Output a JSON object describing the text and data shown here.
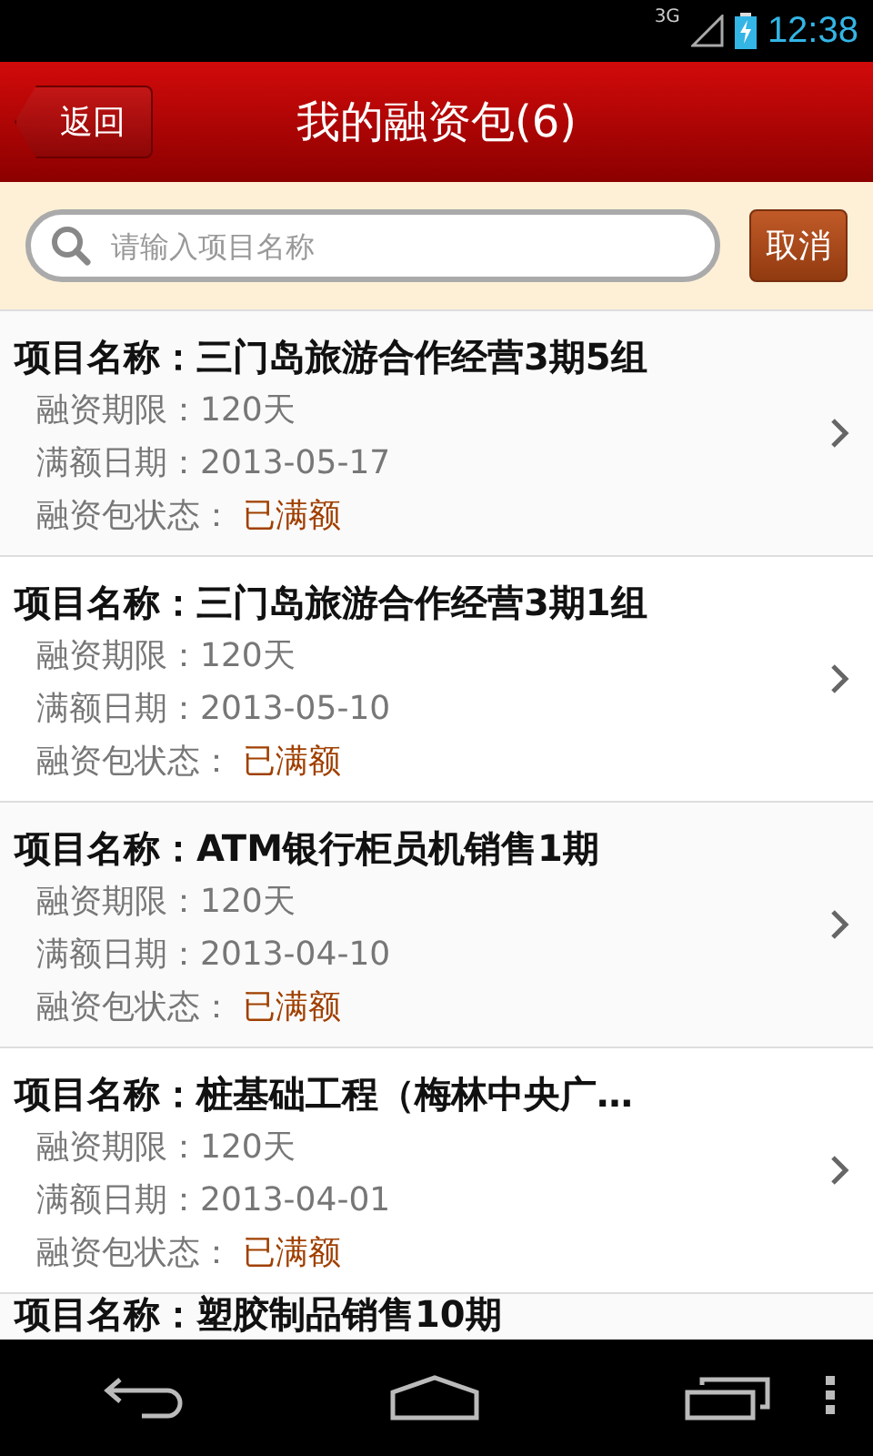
{
  "status_bar": {
    "network": "3G",
    "time": "12:38"
  },
  "header": {
    "back": "返回",
    "title": "我的融资包(6)"
  },
  "search": {
    "placeholder": "请输入项目名称",
    "cancel": "取消"
  },
  "items": [
    {
      "title": "项目名称：三门岛旅游合作经营3期5组",
      "term": "融资期限：120天",
      "date": "满额日期：2013-05-17",
      "status_label": "融资包状态：",
      "status": "已满额"
    },
    {
      "title": "项目名称：三门岛旅游合作经营3期1组",
      "term": "融资期限：120天",
      "date": "满额日期：2013-05-10",
      "status_label": "融资包状态：",
      "status": "已满额"
    },
    {
      "title": "项目名称：ATM银行柜员机销售1期",
      "term": "融资期限：120天",
      "date": "满额日期：2013-04-10",
      "status_label": "融资包状态：",
      "status": "已满额"
    },
    {
      "title": "项目名称：桩基础工程（梅林中央广…",
      "term": "融资期限：120天",
      "date": "满额日期：2013-04-01",
      "status_label": "融资包状态：",
      "status": "已满额"
    },
    {
      "title": "项目名称：塑胶制品销售10期"
    }
  ]
}
